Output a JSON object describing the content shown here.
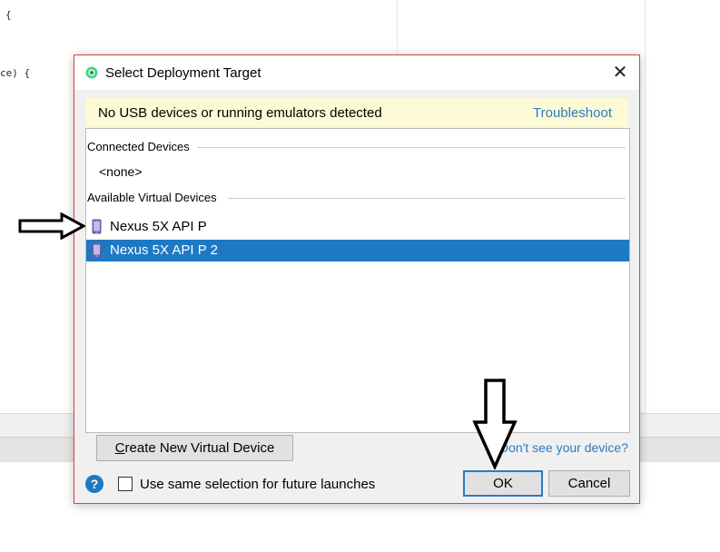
{
  "editor": {
    "code_lines": [
      "{",
      "ce) {"
    ]
  },
  "dialog": {
    "title": "Select Deployment Target",
    "close_glyph": "✕",
    "warning": {
      "text": "No USB devices or running emulators detected",
      "link": "Troubleshoot",
      "color": "#fcfbd6"
    },
    "sections": {
      "connected": "Connected Devices",
      "available": "Available Virtual Devices"
    },
    "connected_empty": "<none>",
    "devices": [
      {
        "label": "Nexus 5X API P",
        "icon": "phone-icon",
        "selected": false
      },
      {
        "label": "Nexus 5X API P 2",
        "icon": "phone-icon",
        "selected": true
      }
    ],
    "create_button": {
      "underline": "C",
      "rest": "reate New Virtual Device"
    },
    "dont_see_link": "Don't see your device?",
    "help_glyph": "?",
    "checkbox_label": "Use same selection for future launches",
    "checkbox_checked": false,
    "ok_label": "OK",
    "cancel_label": "Cancel",
    "accent_color": "#1e79c3"
  },
  "annotations": {
    "arrow_left": "right-pointing-arrow-icon",
    "arrow_ok": "down-pointing-arrow-icon"
  }
}
